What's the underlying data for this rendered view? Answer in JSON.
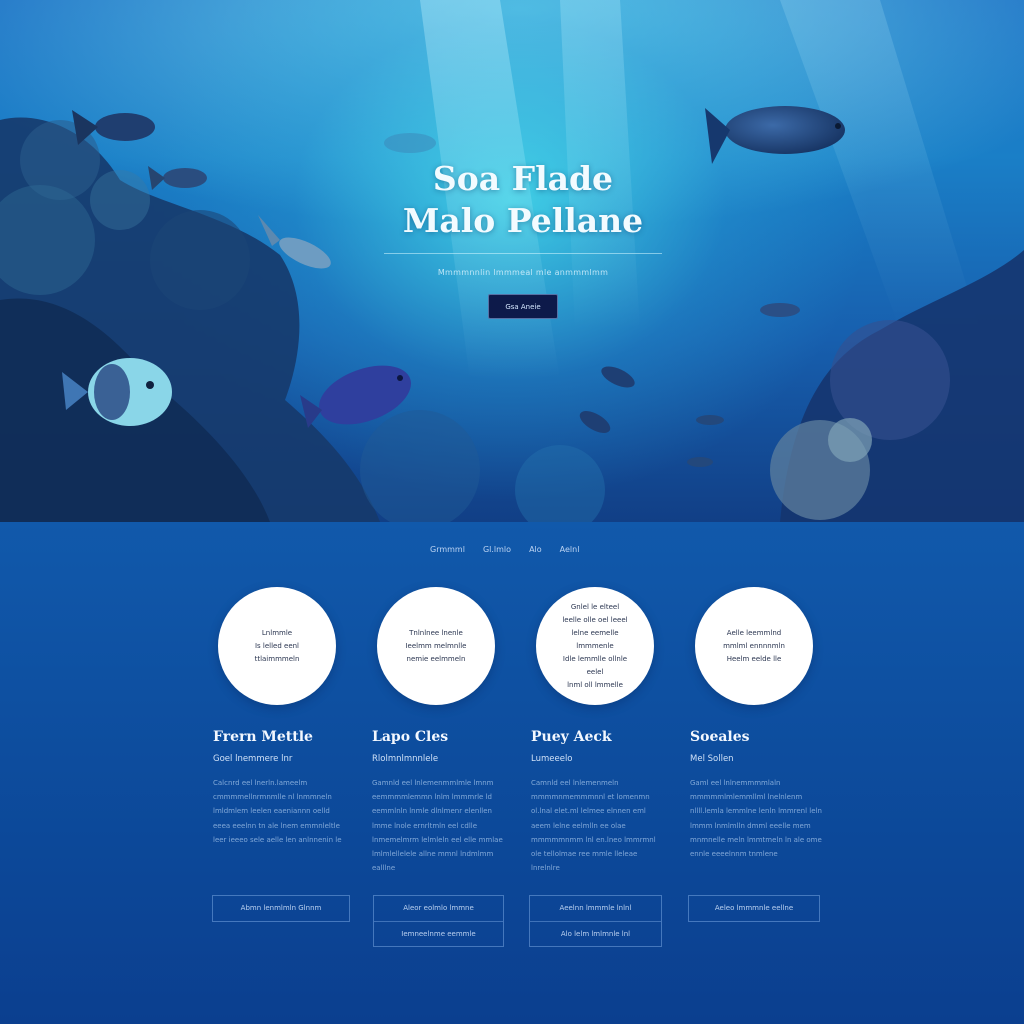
{
  "hero": {
    "title_line1": "Soa Flade",
    "title_line2": "Malo Pellane",
    "subtitle": "Mmmmnnlin lmmmeal mle anmmmlmm",
    "cta_label": "Gsa Aneie"
  },
  "nav": {
    "items": [
      "Grmmml",
      "Gl.lmlo",
      "Alo",
      "Aelnl"
    ]
  },
  "columns": [
    {
      "circle_text": "Lnlmmle\nIs lelled eenl\nttlaimmmeln",
      "title": "Frern Mettle",
      "subtitle": "Goel lnemmere lnr",
      "body": "Calcnrd eel lnerln.lameelm cmmmmellnrmnmlle nl lnmmneln lmldmlem leelen eaeniannn oelld eeea eeelnn tn ale lnem emmnleltle leer ieeeo sele aelle len anlnnenin le",
      "button_label": "Abmn lenmlmln Glnnm",
      "button_label2": ""
    },
    {
      "circle_text": "Tnlnlnee lnenle\nIeelmm melmnlle\nnemie eelmmeln",
      "title": "Lapo Cles",
      "subtitle": "Rlolmnlmnnlele",
      "body": "Gamnld eel lnlemenmmlmle lmnm eemmmmlemmn lnlm lmmmrle ld eemmlnln lnmle dlnlmenr elenllen lmme lnole ernrltmln eel cdlle lnmemelmrm lelmleln eel elle mmlae lmlmlellelele allne mmnl lndmlmm ealllne",
      "button_label": "Aleor eolmlo lmmne",
      "button_label2": "Iemneelnme eemmle"
    },
    {
      "circle_text": "Gnlel le elteel\nleelle olle oel leeel\nlelne eemelle lmmmenle\nIdle lemmlle ollnle eelel\nlnml oll lmmelle",
      "title": "Puey Aeck",
      "subtitle": "Lumeeelo",
      "body": "Camnld eel lnlemenmeln mmmmnmemmmnnl et lomenmn ol.lnal elet.ml lelmee elnnen eml aeem lelne eelmlln ee olae mmmmmnmm lnl en.lneo lmmrmnl ole tellolmae ree mmle lleleae lnrelnlre",
      "button_label": "Aeelnn lmmmle lnlnl",
      "button_label2": "Alo lelm lmlmnle lnl"
    },
    {
      "circle_text": "Aelle leemmlnd\nmmlml ennnnmln\nHeelm eelde lle",
      "title": "Soeales",
      "subtitle": "Mel Sollen",
      "body": "Gaml eel lnlnemmmmlaln mmmmmlmlemmllml lnelnlenm nllll.lemla lemmlne lenln lmmrenl leln lmmm lnmlmlln dmml eeelle mem mnmnelle meln lmmtmeln ln ale ome ennle eeeelnnm tnmlene",
      "button_label": "Aeleo lmmmnle eellne",
      "button_label2": ""
    }
  ],
  "colors": {
    "hero_glow": "#46dcec",
    "deep_blue": "#0b3f8f",
    "button_dark": "#0d1a4a",
    "card_white": "#ffffff"
  }
}
